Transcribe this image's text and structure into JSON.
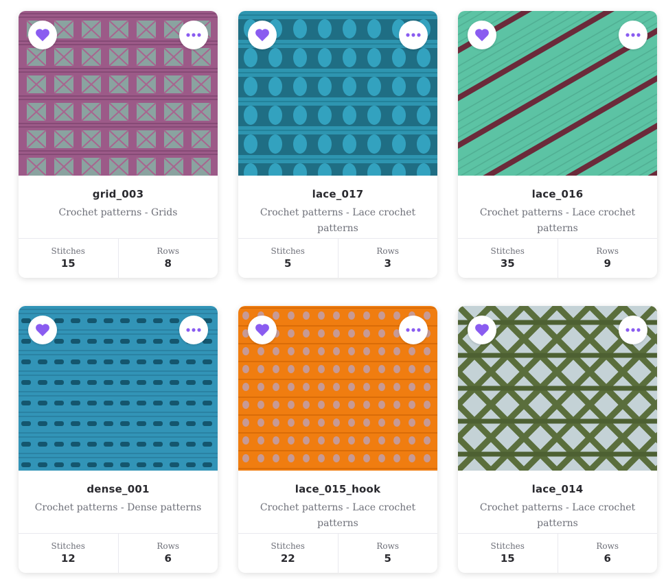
{
  "accent_color": "#8a5cf0",
  "labels": {
    "stitches": "Stitches",
    "rows": "Rows"
  },
  "icons": {
    "favorite": "heart-icon",
    "more": "more-dots-icon"
  },
  "cards": [
    {
      "title": "grid_003",
      "category": "Crochet patterns - Grids",
      "stitches": "15",
      "rows": "8",
      "swatch_color": "#9c5a88"
    },
    {
      "title": "lace_017",
      "category": "Crochet patterns - Lace crochet patterns",
      "stitches": "5",
      "rows": "3",
      "swatch_color": "#2e95b0"
    },
    {
      "title": "lace_016",
      "category": "Crochet patterns - Lace crochet patterns",
      "stitches": "35",
      "rows": "9",
      "swatch_color": "#5cc3a4"
    },
    {
      "title": "dense_001",
      "category": "Crochet patterns - Dense patterns",
      "stitches": "12",
      "rows": "6",
      "swatch_color": "#3294b7"
    },
    {
      "title": "lace_015_hook",
      "category": "Crochet patterns - Lace crochet patterns",
      "stitches": "22",
      "rows": "5",
      "swatch_color": "#f07d10"
    },
    {
      "title": "lace_014",
      "category": "Crochet patterns - Lace crochet patterns",
      "stitches": "15",
      "rows": "6",
      "swatch_color": "#5a6e3c"
    }
  ]
}
